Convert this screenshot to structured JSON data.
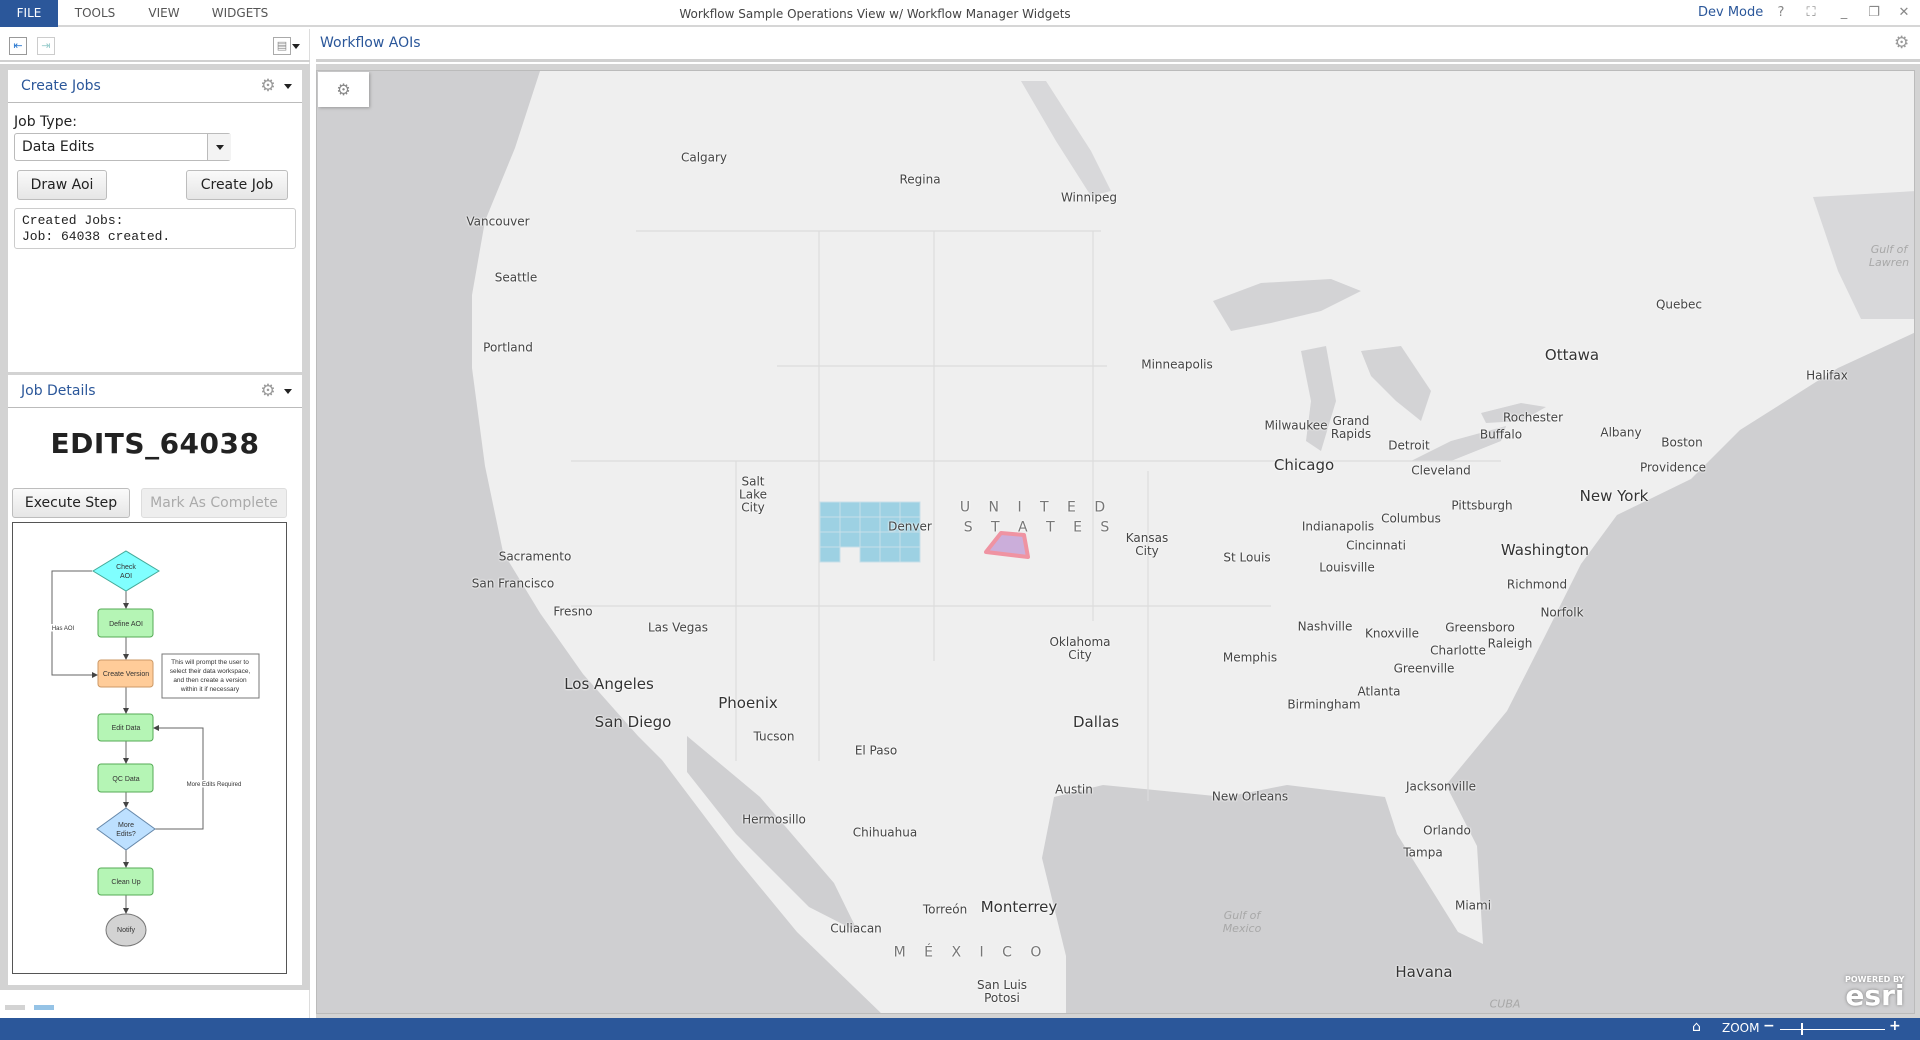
{
  "menubar": {
    "file": "FILE",
    "tools": "TOOLS",
    "view": "VIEW",
    "widgets": "WIDGETS",
    "title": "Workflow Sample Operations View w/ Workflow Manager Widgets",
    "dev_mode": "Dev Mode",
    "help": "?"
  },
  "create_jobs": {
    "title": "Create Jobs",
    "job_type_label": "Job Type:",
    "job_type_value": "Data Edits",
    "draw_aoi": "Draw Aoi",
    "create_job": "Create Job",
    "output_lines": [
      "Created Jobs:",
      "Job: 64038 created."
    ]
  },
  "job_details": {
    "title": "Job Details",
    "job_name": "EDITS_64038",
    "execute_step": "Execute Step",
    "mark_complete": "Mark As Complete",
    "workflow": {
      "check_aoi": [
        "Check",
        "AOI"
      ],
      "define_aoi": "Define AOI",
      "create_version": "Create Version",
      "note": [
        "This will prompt the user to",
        "select their data workspace,",
        "and then create a version",
        "within it if necessary"
      ],
      "edit_data": "Edit Data",
      "qc_data": "QC Data",
      "more_edits": [
        "More",
        "Edits?"
      ],
      "clean_up": "Clean Up",
      "notify": "Notify",
      "has_aoi": "Has AOI",
      "more_edits_required": "More Edits Required"
    }
  },
  "map": {
    "title": "Workflow AOIs",
    "land_color": "#efefef",
    "water_color": "#cfcfd1",
    "aoi_grid_color": "#9dd1e3",
    "aoi_polygon_color": "#c8a8d8",
    "aoi_outline_color": "#f08a9a",
    "labels": [
      "Calgary",
      "Regina",
      "Winnipeg",
      "Vancouver",
      "Seattle",
      "Portland",
      "Minneapolis",
      "Quebec",
      "Ottawa",
      "Halifax",
      "Milwaukee",
      "Grand\nRapids",
      "Detroit",
      "Rochester",
      "Buffalo",
      "Albany",
      "Boston",
      "Providence",
      "Chicago",
      "Cleveland",
      "Salt\nLake\nCity",
      "Pittsburgh",
      "New York",
      "Denver",
      "U N I T E D",
      "S T A T E S",
      "Kansas\nCity",
      "Indianapolis",
      "Columbus",
      "Cincinnati",
      "Washington",
      "Sacramento",
      "St Louis",
      "Louisville",
      "San Francisco",
      "Richmond",
      "Fresno",
      "Norfolk",
      "Las Vegas",
      "Nashville",
      "Knoxville",
      "Greensboro",
      "Oklahoma\nCity",
      "Charlotte",
      "Raleigh",
      "Memphis",
      "Greenville",
      "Los Angeles",
      "Atlanta",
      "Phoenix",
      "Birmingham",
      "San Diego",
      "Dallas",
      "Tucson",
      "El Paso",
      "Jacksonville",
      "Austin",
      "New Orleans",
      "Hermosillo",
      "Chihuahua",
      "Orlando",
      "Tampa",
      "Miami",
      "Gulf of\nMexico",
      "Torreón",
      "Monterrey",
      "Culiacan",
      "M É X I C O",
      "Havana",
      "San Luis\nPotosi",
      "CUBA",
      "Gulf of\nLawren"
    ],
    "attribution": {
      "powered_by": "POWERED BY",
      "logo": "esri"
    }
  },
  "statusbar": {
    "zoom_label": "ZOOM",
    "zoom_minus": "−",
    "zoom_plus": "+",
    "zoom_level": 0.2
  }
}
